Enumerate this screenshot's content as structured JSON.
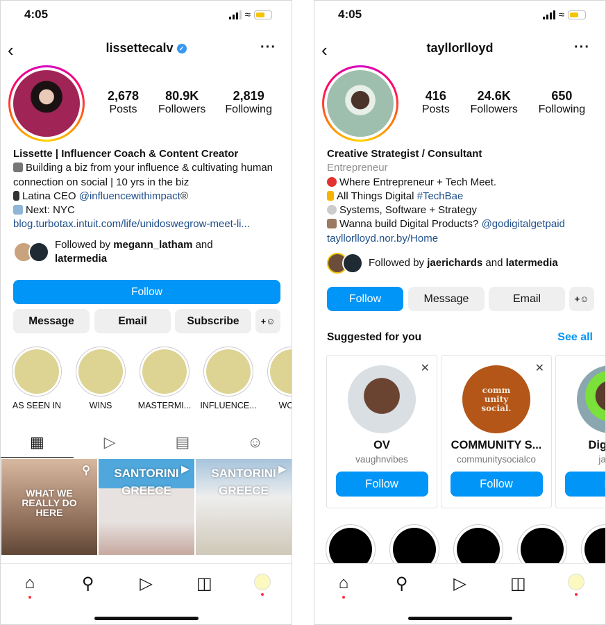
{
  "left": {
    "status": {
      "time": "4:05"
    },
    "username": "lissettecalv",
    "verified": true,
    "stats": [
      {
        "value": "2,678",
        "label": "Posts"
      },
      {
        "value": "80.9K",
        "label": "Followers"
      },
      {
        "value": "2,819",
        "label": "Following"
      }
    ],
    "bio": {
      "name": "Lissette | Influencer Coach & Content Creator",
      "lines": [
        {
          "icon": "woman-technologist-emoji",
          "text": "Building a biz from your influence & cultivating human connection on social | 10 yrs in the biz"
        },
        {
          "icon": "mobile-phone-emoji",
          "text": "Latina CEO ",
          "link": "@influencewithimpact",
          "suffix": "®"
        },
        {
          "icon": "airplane-emoji",
          "text": "Next: NYC"
        }
      ],
      "url": "blog.turbotax.intuit.com/life/unidoswegrow-meet-li..."
    },
    "followed_by": {
      "prefix": "Followed by ",
      "user1": "megann_latham",
      "mid": " and ",
      "user2": "latermedia"
    },
    "buttons": {
      "follow": "Follow",
      "message": "Message",
      "email": "Email",
      "subscribe": "Subscribe"
    },
    "highlights": [
      "AS SEEN IN",
      "WINS",
      "MASTERMI...",
      "INFLUENCE...",
      "WORK"
    ],
    "posts": [
      {
        "text": "WHAT WE REALLY DO HERE"
      },
      {
        "text": "SANTORINI GREECE"
      },
      {
        "text": "SANTORINI GREECE"
      }
    ]
  },
  "right": {
    "status": {
      "time": "4:05"
    },
    "username": "tayllorlloyd",
    "stats": [
      {
        "value": "416",
        "label": "Posts"
      },
      {
        "value": "24.6K",
        "label": "Followers"
      },
      {
        "value": "650",
        "label": "Following"
      }
    ],
    "bio": {
      "name": "Creative Strategist / Consultant",
      "category": "Entrepreneur",
      "lines": [
        {
          "icon": "round-pushpin-emoji",
          "text": "Where Entrepreneur + Tech Meet."
        },
        {
          "icon": "lightning-emoji",
          "text": "All Things Digital ",
          "link": "#TechBae"
        },
        {
          "icon": "dvd-emoji",
          "text": "Systems, Software + Strategy"
        },
        {
          "icon": "woman-technologist-emoji",
          "text": "Wanna build Digital Products? ",
          "link": "@godigitalgetpaid"
        }
      ],
      "url": "tayllorlloyd.nor.by/Home"
    },
    "followed_by": {
      "prefix": "Followed by ",
      "user1": "jaerichards",
      "mid": " and ",
      "user2": "latermedia"
    },
    "buttons": {
      "follow": "Follow",
      "message": "Message",
      "email": "Email"
    },
    "suggested": {
      "title": "Suggested for you",
      "see_all": "See all",
      "cards": [
        {
          "name": "OV",
          "handle": "vaughnvibes",
          "follow": "Follow"
        },
        {
          "name": "COMMUNITY S...",
          "handle": "communitysocialco",
          "follow": "Follow",
          "logo_text": "comm unity social."
        },
        {
          "name": "Digital T",
          "handle": "jasxta",
          "follow": "Fo"
        }
      ]
    }
  },
  "colors": {
    "accent": "#0095f6",
    "link": "#1e4e8a",
    "highlight": "#ddd494",
    "notification": "#ff3040"
  }
}
